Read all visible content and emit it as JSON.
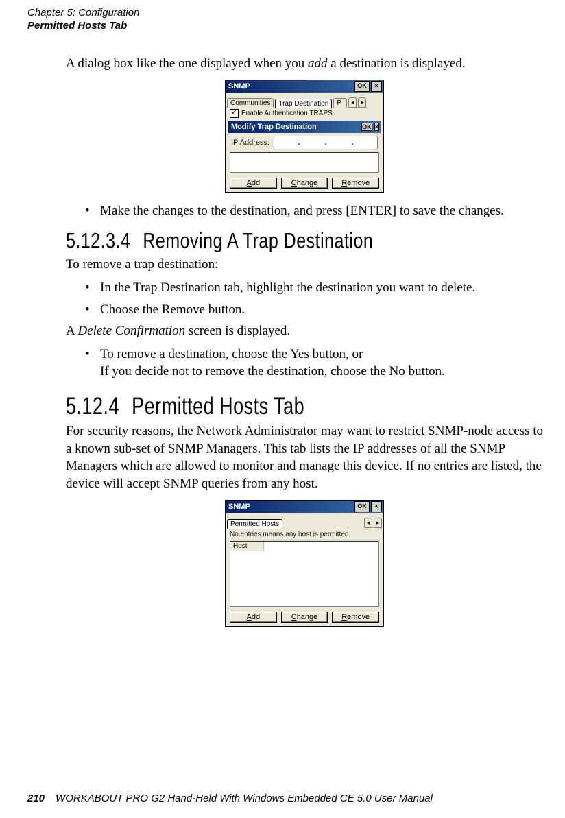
{
  "header": {
    "chapter": "Chapter 5: Configuration",
    "section": "Permitted Hosts Tab"
  },
  "intro_para_pre": "A dialog box like the one displayed when you ",
  "intro_para_italic": "add",
  "intro_para_post": " a destination is displayed.",
  "shot1": {
    "title": "SNMP",
    "ok": "OK",
    "tab_communities": "Communities",
    "tab_trapdest": "Trap Destination",
    "tab_cut": "P",
    "checkbox_label": "Enable Authentication TRAPS",
    "modify_title": "Modify Trap Destination",
    "ip_label": "IP Address:",
    "ip_dots": ". . .",
    "btn_add": "Add",
    "btn_add_ul": "A",
    "btn_change": "Change",
    "btn_change_ul": "C",
    "btn_remove": "Remove",
    "btn_remove_ul": "R"
  },
  "bullet_make_changes": "Make the changes to the destination, and press [ENTER] to save the changes.",
  "h_51234_num": "5.12.3.4",
  "h_51234_title": "Removing A Trap Destination",
  "remove_intro": "To remove a trap destination:",
  "bullet_in_trap_pre": "In the ",
  "bullet_in_trap_italic": "Trap Destination",
  "bullet_in_trap_post": " tab, highlight the destination you want to delete.",
  "bullet_choose_pre": "Choose the ",
  "bullet_choose_bold": "Remove",
  "bullet_choose_post": " button.",
  "delete_conf_pre": "A ",
  "delete_conf_italic": "Delete Confirmation",
  "delete_conf_post": " screen is displayed.",
  "bullet_yes_pre": "To remove a destination, choose the ",
  "bullet_yes_bold": "Yes",
  "bullet_yes_mid": " button, ",
  "bullet_yes_italic": "or",
  "bullet_no_pre": "If you decide not to remove the destination, choose the ",
  "bullet_no_bold": "No",
  "bullet_no_post": " button.",
  "h_5124_num": "5.12.4",
  "h_5124_title": "Permitted Hosts Tab",
  "permitted_para": "For security reasons, the Network Administrator may want to restrict SNMP-node access to a known sub-set of SNMP Managers. This tab lists the IP addresses of all the SNMP Managers which are allowed to monitor and manage this device. If no entries are listed, the device will accept SNMP queries from any host.",
  "shot2": {
    "title": "SNMP",
    "ok": "OK",
    "tab_permitted": "Permitted Hosts",
    "msg": "No entries means any host is permitted.",
    "col_host": "Host",
    "btn_add": "Add",
    "btn_add_ul": "A",
    "btn_change": "Change",
    "btn_change_ul": "C",
    "btn_remove": "Remove",
    "btn_remove_ul": "R"
  },
  "footer": {
    "page": "210",
    "text": "WORKABOUT PRO G2 Hand-Held With Windows Embedded CE 5.0 User Manual"
  }
}
